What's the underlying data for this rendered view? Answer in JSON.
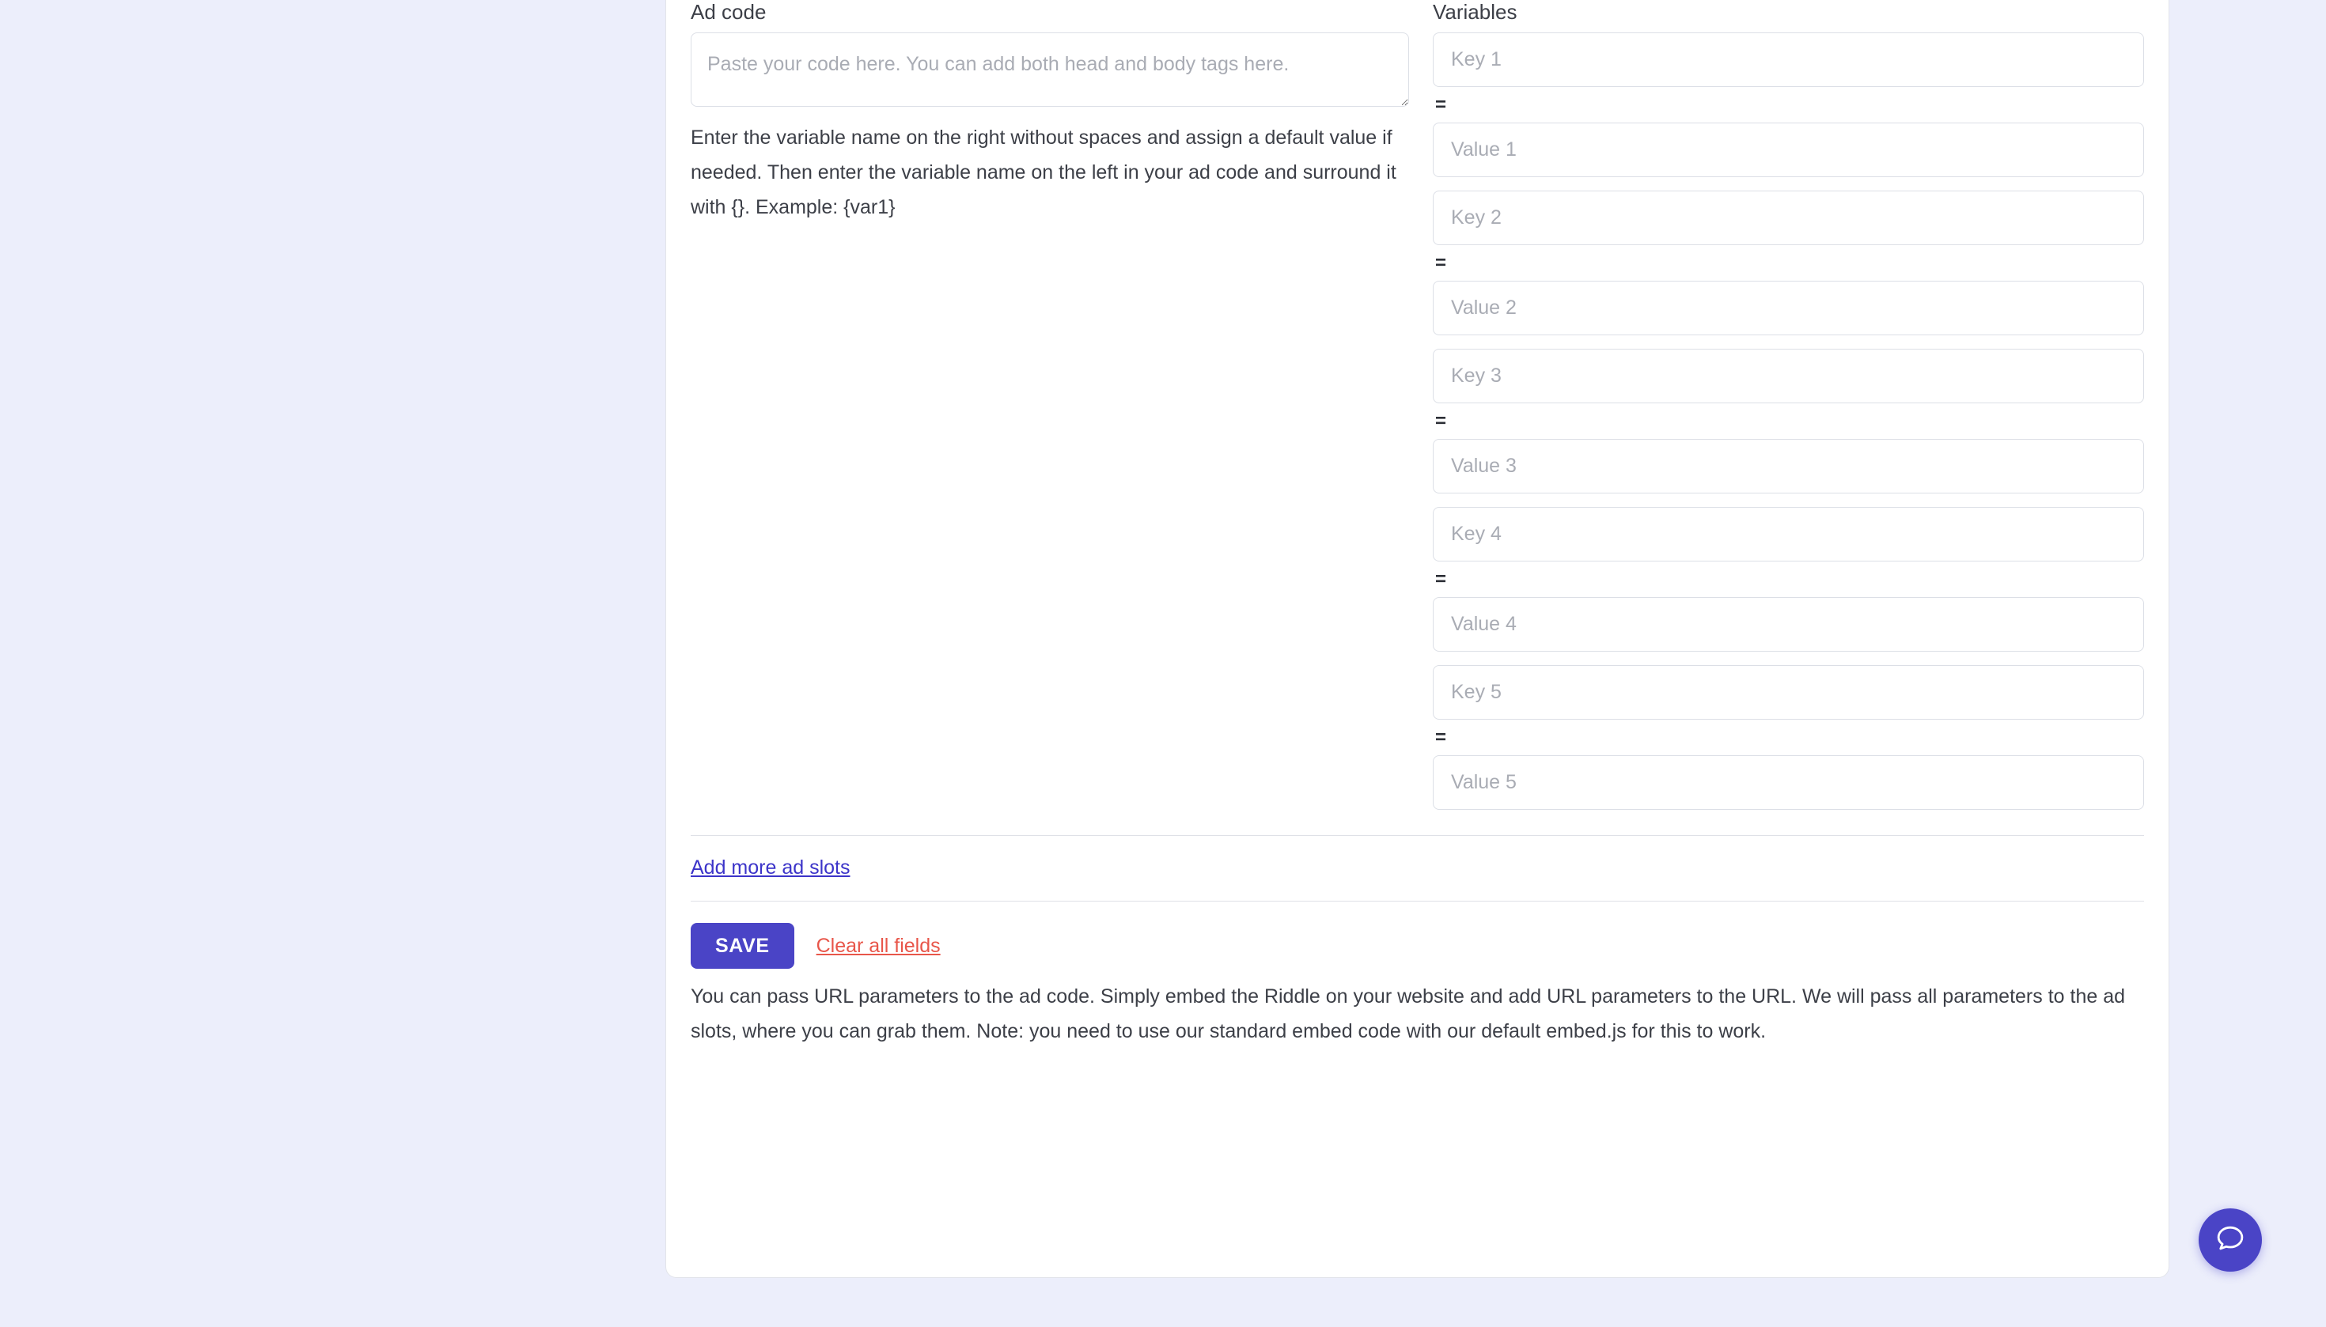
{
  "ad_code": {
    "label": "Ad code",
    "placeholder": "Paste your code here. You can add both head and body tags here.",
    "value": "",
    "helper_text": "Enter the variable name on the right without spaces and assign a default value if needed. Then enter the variable name on the left in your ad code and surround it with {}. Example: {var1}"
  },
  "variables": {
    "label": "Variables",
    "equals_symbol": "=",
    "pairs": [
      {
        "key_placeholder": "Key 1",
        "key_value": "",
        "value_placeholder": "Value 1",
        "value_value": ""
      },
      {
        "key_placeholder": "Key 2",
        "key_value": "",
        "value_placeholder": "Value 2",
        "value_value": ""
      },
      {
        "key_placeholder": "Key 3",
        "key_value": "",
        "value_placeholder": "Value 3",
        "value_value": ""
      },
      {
        "key_placeholder": "Key 4",
        "key_value": "",
        "value_placeholder": "Value 4",
        "value_value": ""
      },
      {
        "key_placeholder": "Key 5",
        "key_value": "",
        "value_placeholder": "Value 5",
        "value_value": ""
      }
    ]
  },
  "add_more_link": "Add more ad slots",
  "actions": {
    "save_label": "SAVE",
    "clear_label": "Clear all fields"
  },
  "footer_note": "You can pass URL parameters to the ad code. Simply embed the Riddle on your website and add URL parameters to the URL. We will pass all parameters to the ad slots, where you can grab them. Note: you need to use our standard embed code with our default embed.js for this to work.",
  "chat_widget": {
    "icon": "chat-bubble-icon"
  },
  "colors": {
    "page_background": "#eceefb",
    "accent": "#4a44c6",
    "link": "#3c34c9",
    "danger": "#e8564a",
    "text": "#3c3f47",
    "placeholder": "#a9acb4",
    "border": "#dcdfe6"
  }
}
